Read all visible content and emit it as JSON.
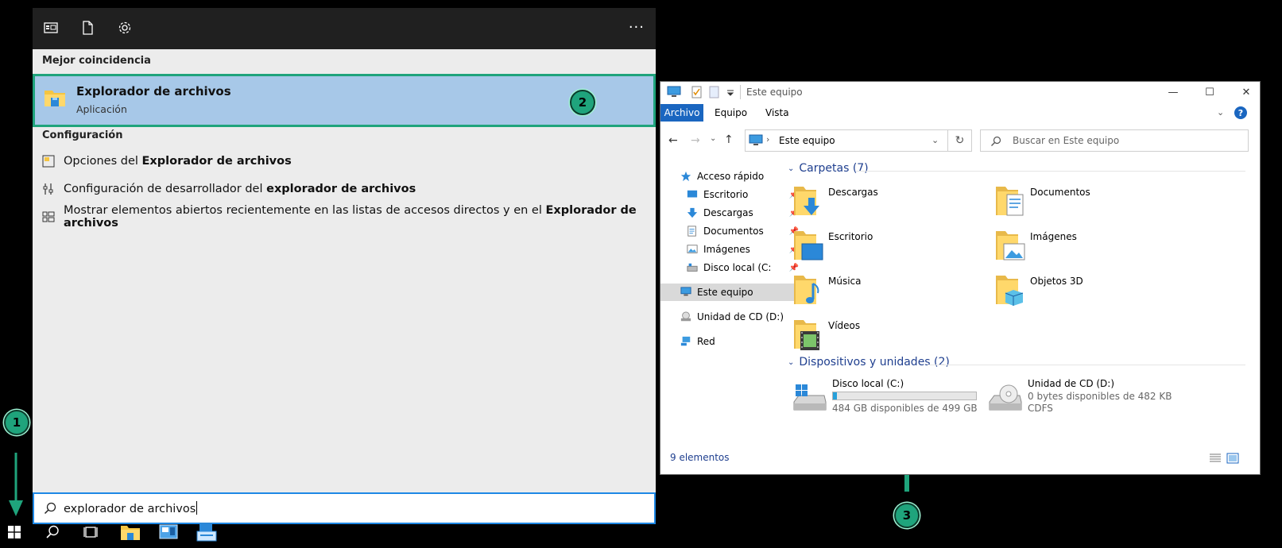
{
  "start_panel": {
    "toolbar_icons": [
      "apps-icon",
      "document-icon",
      "settings-gear-icon"
    ],
    "more_label": "···",
    "best_match_header": "Mejor coincidencia",
    "best_match": {
      "title": "Explorador de archivos",
      "subtitle": "Aplicación",
      "icon": "file-explorer-icon"
    },
    "config_header": "Configuración",
    "config_items": [
      {
        "prefix": "Opciones del ",
        "bold": "Explorador de archivos",
        "icon": "folder-options-icon"
      },
      {
        "prefix": "Configuración de desarrollador del ",
        "bold": "explorador de archivos",
        "icon": "developer-settings-icon"
      },
      {
        "prefix": "Mostrar elementos abiertos recientemente en las listas de accesos directos y en el ",
        "bold": "Explorador de archivos",
        "icon": "start-layout-icon"
      }
    ],
    "search": {
      "value": "explorador de archivos",
      "icon": "search-icon"
    }
  },
  "badges": {
    "one": "1",
    "two": "2",
    "three": "3"
  },
  "taskbar": {
    "items": [
      "windows-start-icon",
      "search-icon",
      "task-view-icon",
      "file-explorer-icon",
      "server-manager-icon",
      "network-share-icon"
    ]
  },
  "explorer": {
    "title": "Este equipo",
    "window_controls": {
      "minimize": "—",
      "maximize": "☐",
      "close": "✕"
    },
    "ribbon_tabs": [
      "Archivo",
      "Equipo",
      "Vista"
    ],
    "address": "Este equipo",
    "search_placeholder": "Buscar en Este equipo",
    "nav": [
      {
        "label": "Acceso rápido",
        "icon": "star-icon",
        "indent": false,
        "pinned": false
      },
      {
        "label": "Escritorio",
        "icon": "desktop-icon",
        "indent": true,
        "pinned": true
      },
      {
        "label": "Descargas",
        "icon": "download-icon",
        "indent": true,
        "pinned": true
      },
      {
        "label": "Documentos",
        "icon": "documents-icon",
        "indent": true,
        "pinned": true
      },
      {
        "label": "Imágenes",
        "icon": "pictures-icon",
        "indent": true,
        "pinned": true
      },
      {
        "label": "Disco local (C:",
        "icon": "local-disk-icon",
        "indent": true,
        "pinned": true
      },
      {
        "label": "Este equipo",
        "icon": "this-pc-icon",
        "indent": false,
        "pinned": false,
        "selected": true
      },
      {
        "label": "Unidad de CD (D:)",
        "icon": "cd-drive-icon",
        "indent": false,
        "pinned": false
      },
      {
        "label": "Red",
        "icon": "network-icon",
        "indent": false,
        "pinned": false
      }
    ],
    "folders_header": "Carpetas (7)",
    "folders": [
      {
        "name": "Descargas",
        "icon": "downloads-folder-icon"
      },
      {
        "name": "Documentos",
        "icon": "documents-folder-icon"
      },
      {
        "name": "Escritorio",
        "icon": "desktop-folder-icon"
      },
      {
        "name": "Imágenes",
        "icon": "pictures-folder-icon"
      },
      {
        "name": "Música",
        "icon": "music-folder-icon"
      },
      {
        "name": "Objetos 3D",
        "icon": "3d-objects-folder-icon"
      },
      {
        "name": "Vídeos",
        "icon": "videos-folder-icon"
      }
    ],
    "drives_header": "Dispositivos y unidades (2)",
    "drives": [
      {
        "name": "Disco local (C:)",
        "free": "484 GB disponibles de 499 GB",
        "used_fraction": 0.03,
        "icon": "local-disk-icon"
      },
      {
        "name": "Unidad de CD (D:)",
        "free": "0 bytes disponibles de 482 KB",
        "fs": "CDFS",
        "icon": "cd-drive-icon"
      }
    ],
    "status": "9 elementos",
    "accent_color": "#1a66c0"
  },
  "colors": {
    "badge": "#1fa47c",
    "selection": "#a7c8e8",
    "search_border": "#1e88e5"
  }
}
